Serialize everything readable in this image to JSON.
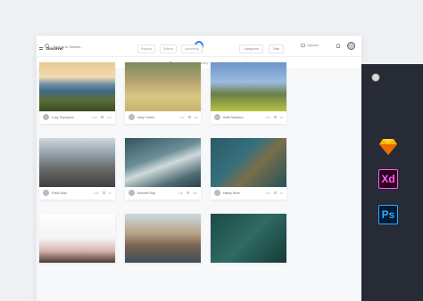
{
  "search": {
    "placeholder": "Type in to Search..."
  },
  "header": {
    "upload_label": "Upload"
  },
  "nav": {
    "tabs": [
      {
        "label": "Following"
      },
      {
        "label": "Discover"
      },
      {
        "label": "Activity"
      },
      {
        "label": "Groups"
      },
      {
        "label": "Gallery"
      }
    ]
  },
  "section": {
    "title": "Discover"
  },
  "filters": [
    "Popular",
    "Editors",
    "Upcoming"
  ],
  "sort": {
    "primary": "Categories",
    "secondary": "Date"
  },
  "cards": [
    {
      "user": "Lucy Thompson",
      "views": "3.4k",
      "likes": "104"
    },
    {
      "user": "Mary Turner",
      "views": "2.1k",
      "likes": "88"
    },
    {
      "user": "Keith Morrison",
      "views": "1.8k",
      "likes": "61"
    },
    {
      "user": "Frank Diaz",
      "views": "2.9k",
      "likes": "97"
    },
    {
      "user": "Kenneth Ray",
      "views": "4.2k",
      "likes": "150"
    },
    {
      "user": "Hailey Rose",
      "views": "1.5k",
      "likes": "42"
    },
    {
      "user": "Anna Grey",
      "views": "0.9k",
      "likes": "33"
    },
    {
      "user": "Tom Hardy",
      "views": "2.6k",
      "likes": "71"
    },
    {
      "user": "Ryan Cole",
      "views": "3.1k",
      "likes": "99"
    }
  ],
  "tools": {
    "xd": "Xd",
    "ps": "Ps"
  },
  "colors": {
    "accent": "#2f7bf5",
    "dark_panel": "#262b36"
  },
  "icons": [
    "search-icon",
    "logo-icon",
    "upload-icon",
    "bell-icon",
    "menu-icon",
    "heart-icon",
    "sketch-icon"
  ]
}
